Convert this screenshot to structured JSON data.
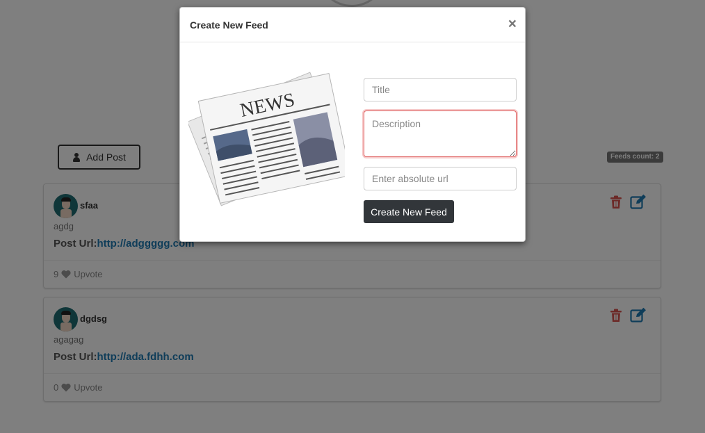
{
  "page": {
    "add_post_label": "Add Post",
    "feeds_count_label": "Feeds count: 2",
    "posts": [
      {
        "author": "sfaa",
        "description": "agdg",
        "url_label": "Post Url:",
        "url": "http://adggggg.com",
        "upvotes": "9",
        "upvote_label": "Upvote"
      },
      {
        "author": "dgdsg",
        "description": "agagag",
        "url_label": "Post Url:",
        "url": "http://ada.fdhh.com",
        "upvotes": "0",
        "upvote_label": "Upvote"
      }
    ]
  },
  "modal": {
    "title": "Create New Feed",
    "close_glyph": "×",
    "image_text": "NEWS",
    "title_placeholder": "Title",
    "description_placeholder": "Description",
    "url_placeholder": "Enter absolute url",
    "submit_label": "Create New Feed"
  },
  "colors": {
    "overlay": "#808080",
    "link": "#1f7ab3",
    "delete_icon": "#d9534f",
    "edit_icon": "#1f7ab3",
    "submit_button": "#32363a",
    "invalid_border": "#e06666"
  },
  "icons": [
    "user-icon",
    "trash-icon",
    "edit-icon",
    "heart-icon",
    "close-icon",
    "newspaper-image"
  ]
}
